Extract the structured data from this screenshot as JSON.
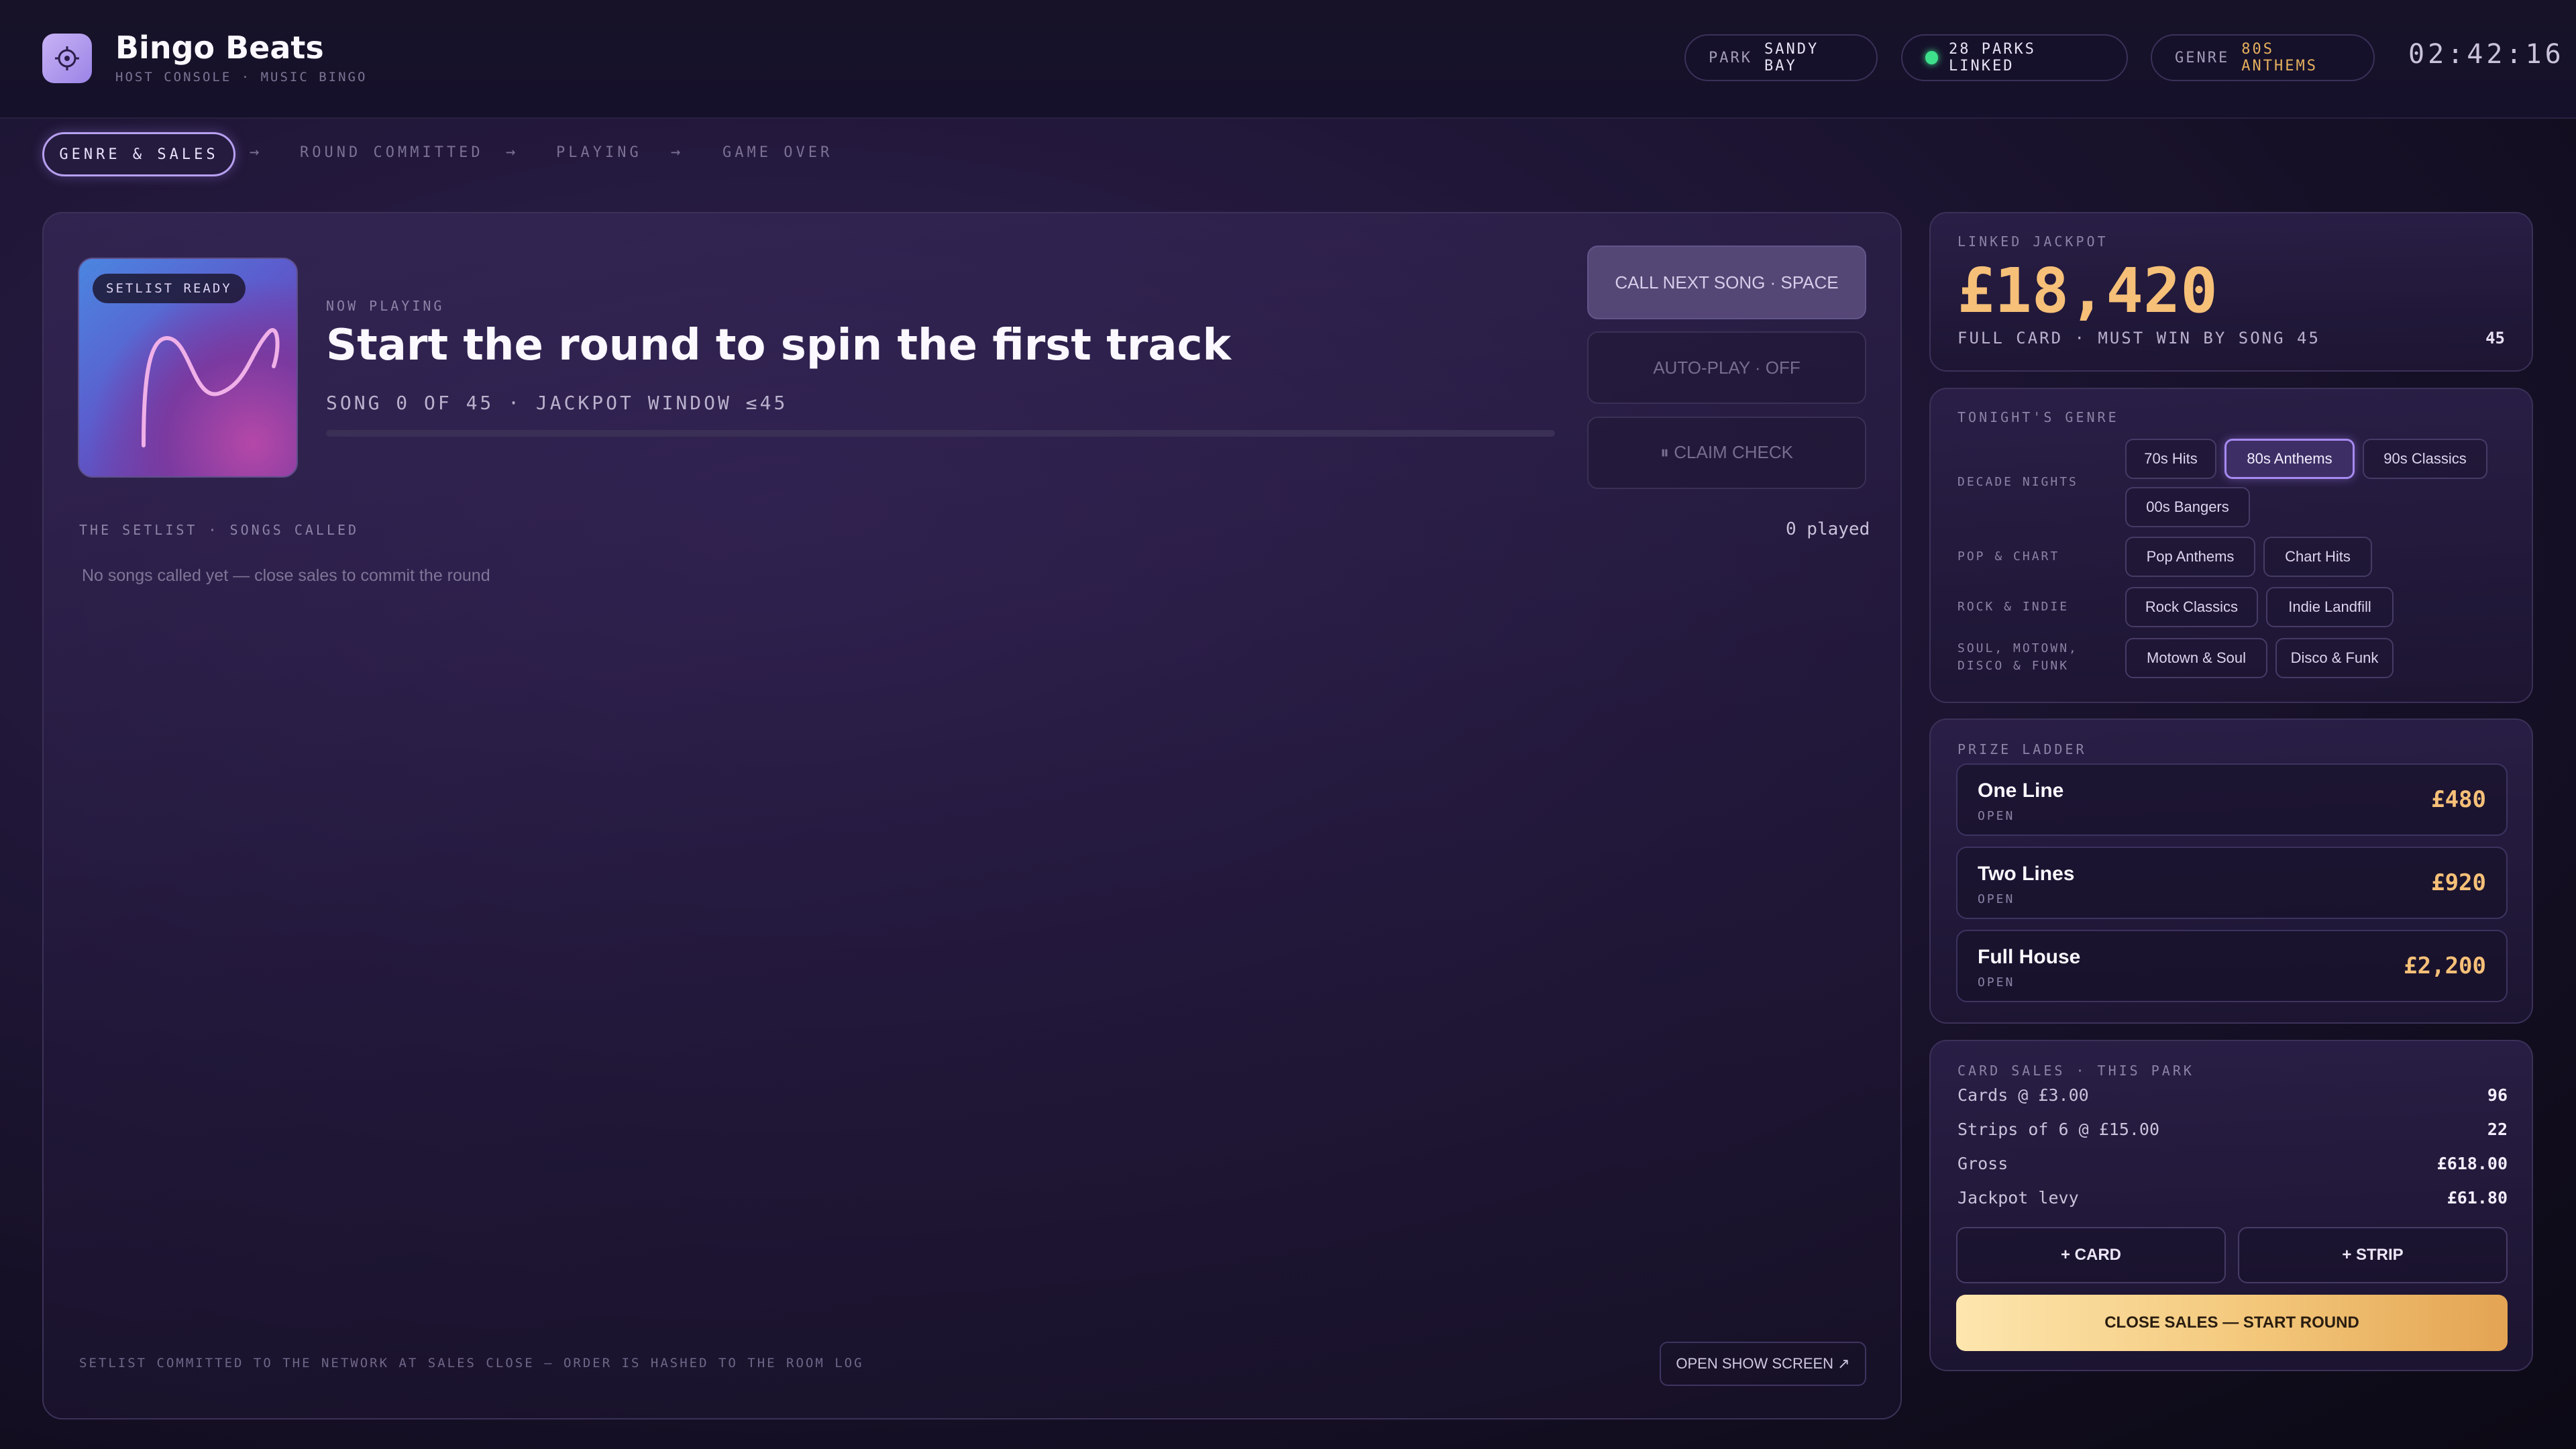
{
  "app": {
    "title": "Bingo Beats",
    "subtitle": "HOST CONSOLE · MUSIC BINGO"
  },
  "header": {
    "park": {
      "label": "PARK",
      "value": "SANDY BAY"
    },
    "linked": {
      "value": "28 PARKS LINKED",
      "status_color": "#3ee08b"
    },
    "genre": {
      "label": "GENRE",
      "value": "80S ANTHEMS"
    },
    "clock": "02:42:16"
  },
  "steps": {
    "genre_sales": "GENRE & SALES",
    "round_committed": "ROUND COMMITTED",
    "playing": "PLAYING",
    "game_over": "GAME OVER",
    "arrow": "→"
  },
  "now_playing": {
    "badge": "SETLIST READY",
    "label": "NOW PLAYING",
    "title": "Start the round to spin the first track",
    "meta": "SONG 0 OF 45 · JACKPOT WINDOW ≤45",
    "progress": 0
  },
  "controls": {
    "call_next": "CALL NEXT SONG · SPACE",
    "auto_play": "AUTO-PLAY · OFF",
    "claim_check": "⏸ CLAIM CHECK"
  },
  "setlist": {
    "label": "THE SETLIST · SONGS CALLED",
    "played": "0 played",
    "empty": "No songs called yet — close sales to commit the round"
  },
  "footer": {
    "note": "SETLIST COMMITTED TO THE NETWORK AT SALES CLOSE — ORDER IS HASHED TO THE ROOM LOG",
    "show_screen": "OPEN SHOW SCREEN ↗"
  },
  "jackpot": {
    "label": "LINKED JACKPOT",
    "value": "£18,420",
    "sub": "FULL CARD · MUST WIN BY SONG 45",
    "song_limit": "45"
  },
  "genre_panel": {
    "label": "TONIGHT'S GENRE",
    "groups": [
      {
        "label": "DECADE NIGHTS",
        "chips": [
          "70s Hits",
          "80s Anthems",
          "90s Classics",
          "00s Bangers"
        ]
      },
      {
        "label": "POP & CHART",
        "chips": [
          "Pop Anthems",
          "Chart Hits"
        ]
      },
      {
        "label": "ROCK & INDIE",
        "chips": [
          "Rock Classics",
          "Indie Landfill"
        ]
      },
      {
        "label_line1": "SOUL, MOTOWN,",
        "label_line2": "DISCO & FUNK",
        "chips": [
          "Motown & Soul",
          "Disco & Funk"
        ]
      }
    ],
    "selected": "80s Anthems"
  },
  "prize_ladder": {
    "label": "PRIZE LADDER",
    "prizes": [
      {
        "name": "One Line",
        "status": "OPEN",
        "amount": "£480"
      },
      {
        "name": "Two Lines",
        "status": "OPEN",
        "amount": "£920"
      },
      {
        "name": "Full House",
        "status": "OPEN",
        "amount": "£2,200"
      }
    ]
  },
  "sales": {
    "label": "CARD SALES · THIS PARK",
    "rows": [
      {
        "label": "Cards @ £3.00",
        "value": "96"
      },
      {
        "label": "Strips of 6 @ £15.00",
        "value": "22"
      },
      {
        "label": "Gross",
        "value": "£618.00"
      },
      {
        "label": "Jackpot levy",
        "value": "£61.80"
      }
    ],
    "add_card": "+ CARD",
    "add_strip": "+ STRIP",
    "close": "CLOSE SALES — START ROUND"
  }
}
